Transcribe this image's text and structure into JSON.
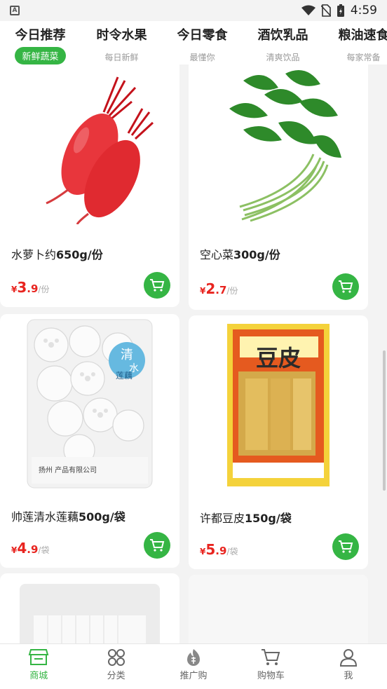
{
  "status_bar": {
    "app_badge": "A",
    "time": "4:59"
  },
  "tabs": [
    {
      "title": "今日推荐",
      "sub": "新鲜蔬菜",
      "active": true
    },
    {
      "title": "时令水果",
      "sub": "每日新鲜",
      "active": false
    },
    {
      "title": "今日零食",
      "sub": "最懂你",
      "active": false
    },
    {
      "title": "酒饮乳品",
      "sub": "清爽饮品",
      "active": false
    },
    {
      "title": "粮油速食",
      "sub": "每家常备",
      "active": false
    }
  ],
  "products": [
    {
      "name_plain": "水萝卜约",
      "name_bold": "650g/份",
      "yen": "¥",
      "price_int": "3",
      "price_dec": ".9",
      "unit": "/份"
    },
    {
      "name_plain": "空心菜",
      "name_bold": "300g/份",
      "yen": "¥",
      "price_int": "2",
      "price_dec": ".7",
      "unit": "/份"
    },
    {
      "name_plain": "帅莲清水莲藕",
      "name_bold": "500g/袋",
      "yen": "¥",
      "price_int": "4",
      "price_dec": ".9",
      "unit": "/袋"
    },
    {
      "name_plain": "许都豆皮",
      "name_bold": "150g/袋",
      "yen": "¥",
      "price_int": "5",
      "price_dec": ".9",
      "unit": "/袋"
    }
  ],
  "packaging": {
    "lotus_brand_a": "清",
    "lotus_brand_b": "水",
    "lotus_name": "莲藕",
    "lotus_footer": "扬州          产品有限公司",
    "doupi_title": "豆皮"
  },
  "bottom_nav": [
    {
      "label": "商城",
      "icon": "store-icon",
      "active": true
    },
    {
      "label": "分类",
      "icon": "category-icon",
      "active": false
    },
    {
      "label": "推广购",
      "icon": "promote-icon",
      "active": false
    },
    {
      "label": "购物车",
      "icon": "cart-icon",
      "active": false
    },
    {
      "label": "我",
      "icon": "profile-icon",
      "active": false
    }
  ],
  "colors": {
    "accent": "#35b544",
    "price": "#e8241f"
  }
}
